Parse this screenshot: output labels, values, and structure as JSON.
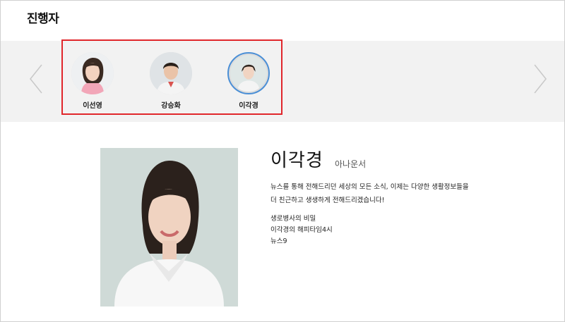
{
  "section": {
    "title": "진행자"
  },
  "carousel": {
    "prev_icon": "chevron-left-icon",
    "next_icon": "chevron-right-icon",
    "highlight_color": "#e0262b",
    "selected_ring_color": "#4a8fd6",
    "hosts": [
      {
        "name": "이선영",
        "selected": false
      },
      {
        "name": "강승화",
        "selected": false
      },
      {
        "name": "이각경",
        "selected": true
      }
    ]
  },
  "profile": {
    "name": "이각경",
    "role": "아나운서",
    "description_lines": [
      "뉴스를 통해 전해드리던 세상의 모든 소식, 이제는 다양한 생활정보들을",
      "더 친근하고 생생하게 전해드리겠습니다!"
    ],
    "programs": [
      "생로병사의 비밀",
      "이각경의 해피타임4시",
      "뉴스9"
    ]
  }
}
